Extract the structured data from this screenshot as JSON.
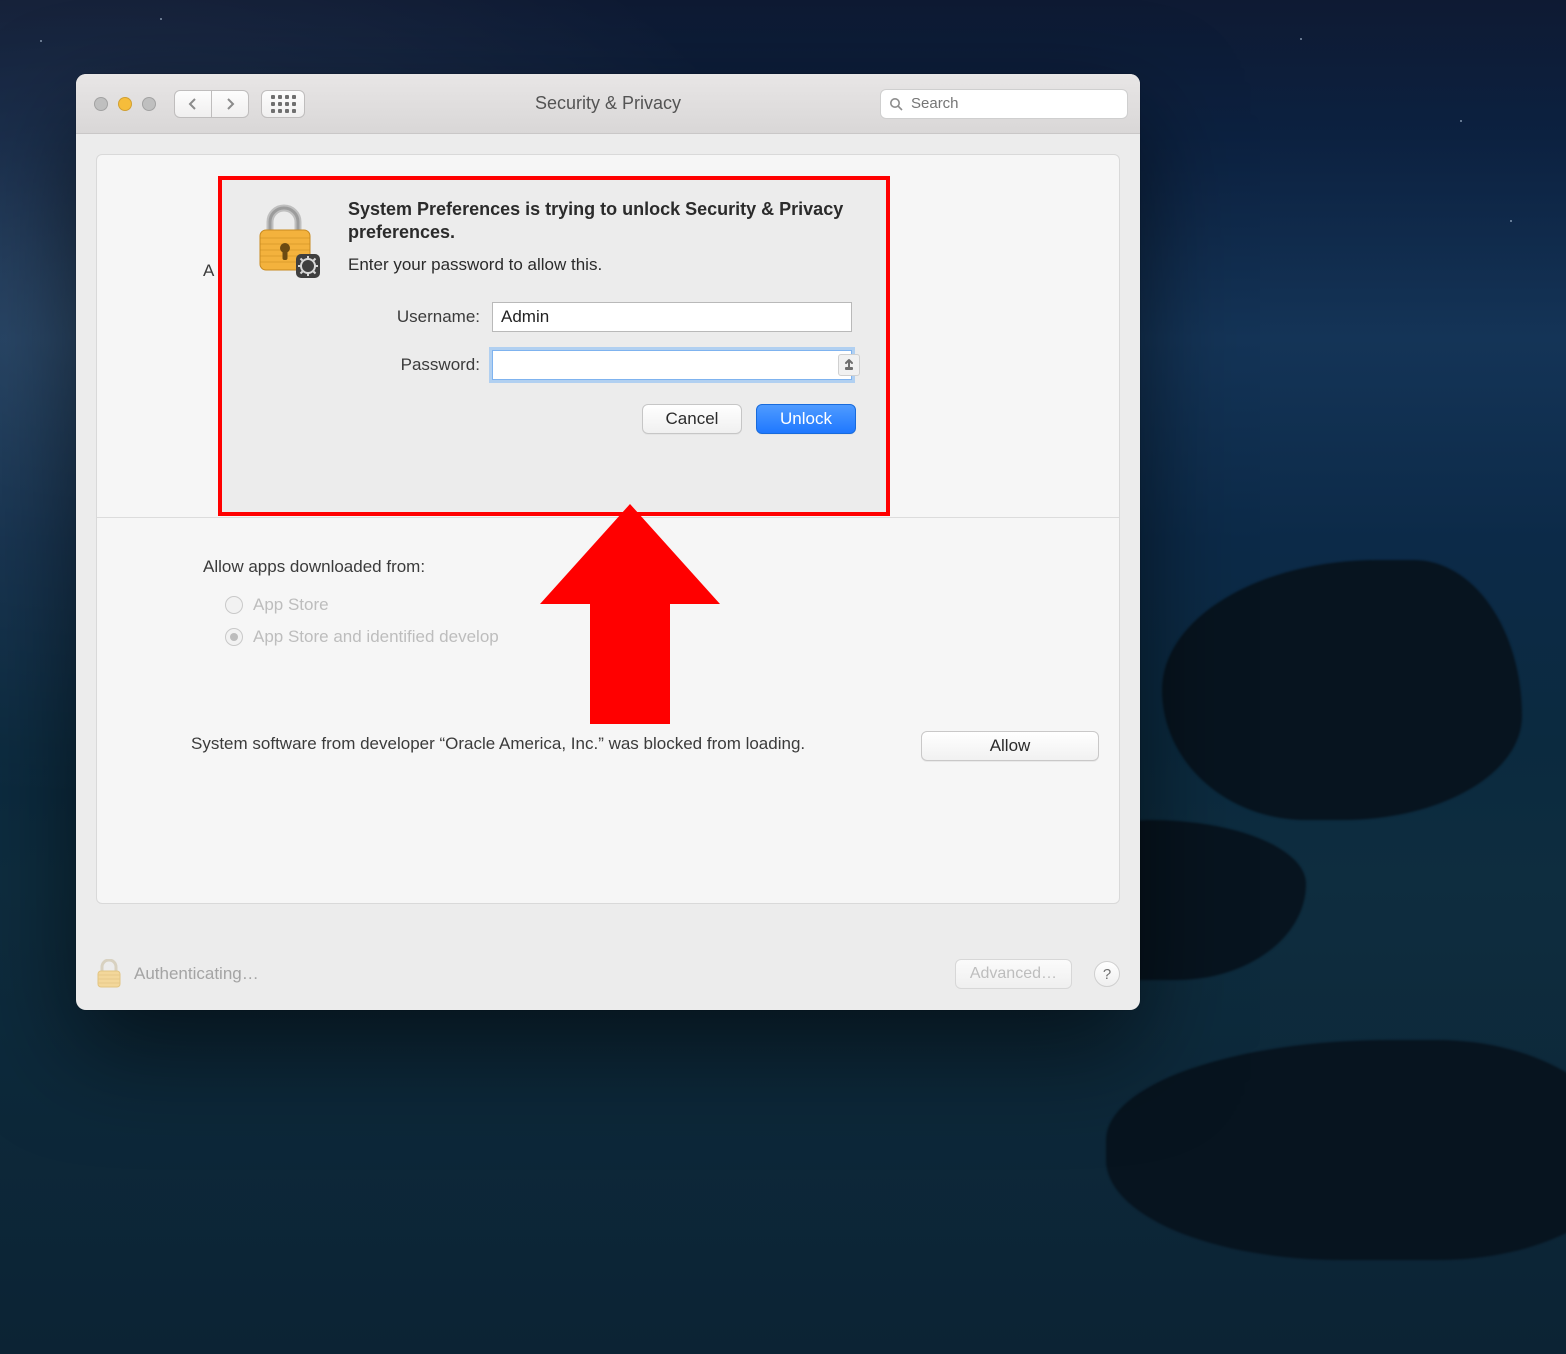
{
  "window": {
    "title": "Security & Privacy",
    "search_placeholder": "Search"
  },
  "panel": {
    "partial_login_text": "A log",
    "section_title": "Allow apps downloaded from:",
    "radio_options": [
      {
        "label": "App Store",
        "selected": false
      },
      {
        "label": "App Store and identified develop",
        "selected": true
      }
    ],
    "blocked_text": "System software from developer “Oracle America, Inc.” was blocked from loading.",
    "allow_button": "Allow"
  },
  "bottom": {
    "status": "Authenticating…",
    "advanced": "Advanced…",
    "help": "?"
  },
  "sheet": {
    "title": "System Preferences is trying to unlock Security & Privacy preferences.",
    "subtitle": "Enter your password to allow this.",
    "username_label": "Username:",
    "username_value": "Admin",
    "password_label": "Password:",
    "password_value": "",
    "cancel": "Cancel",
    "unlock": "Unlock"
  },
  "icons": {
    "search": "search-icon",
    "keychain": "keychain-icon"
  }
}
